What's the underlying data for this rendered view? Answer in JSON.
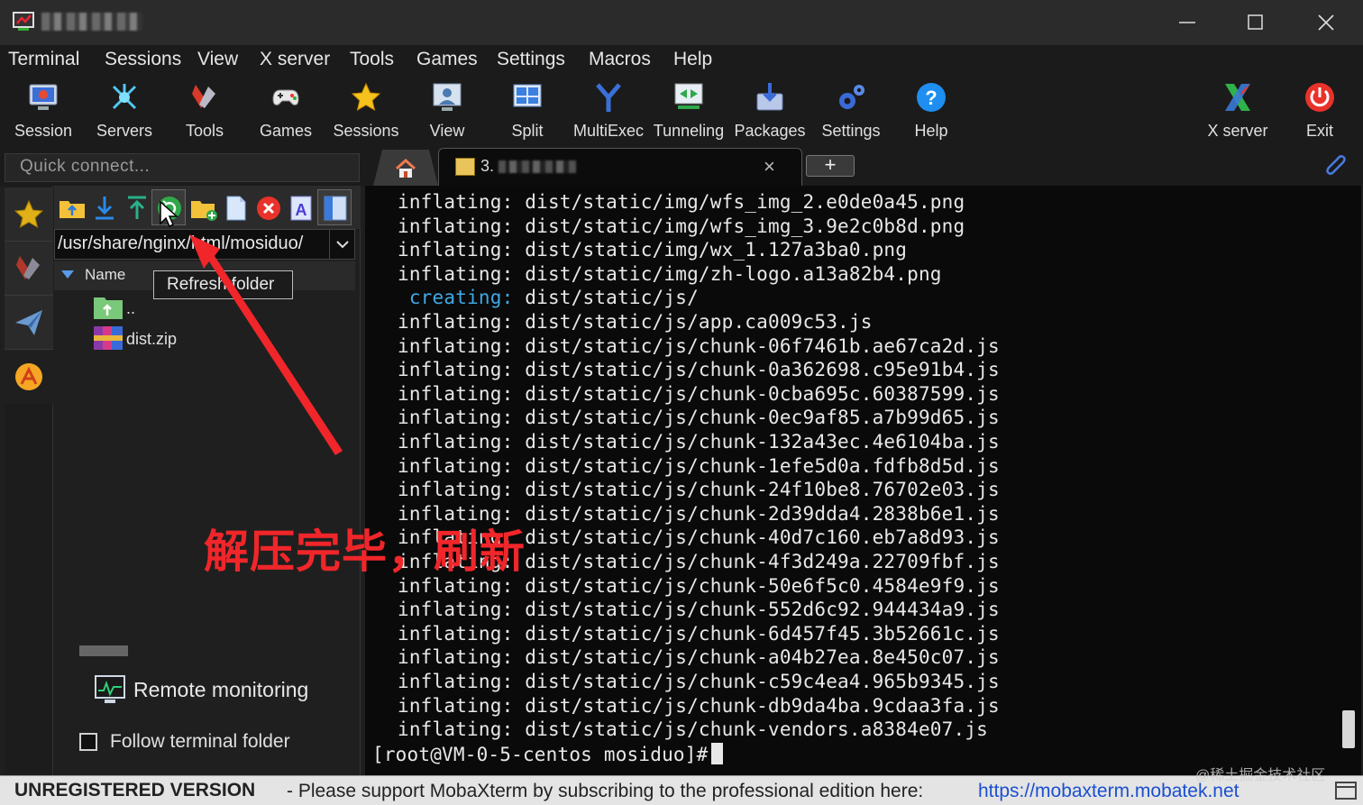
{
  "menu": [
    "Terminal",
    "Sessions",
    "View",
    "X server",
    "Tools",
    "Games",
    "Settings",
    "Macros",
    "Help"
  ],
  "toolbar": {
    "buttons": [
      "Session",
      "Servers",
      "Tools",
      "Games",
      "Sessions",
      "View",
      "Split",
      "MultiExec",
      "Tunneling",
      "Packages",
      "Settings",
      "Help"
    ],
    "right_buttons": [
      "X server",
      "Exit"
    ]
  },
  "quick_connect": {
    "placeholder": "Quick connect..."
  },
  "tabs": {
    "terminal_tab_prefix": "3."
  },
  "sftp": {
    "path": "/usr/share/nginx/html/mosiduo/",
    "column_name": "Name",
    "files": [
      "..",
      "dist.zip"
    ],
    "tooltip": "Refresh folder",
    "remote_monitoring": "Remote monitoring",
    "follow_terminal": "Follow terminal folder"
  },
  "terminal": {
    "lines": [
      {
        "verb": "inflating:",
        "path": "dist/static/img/wfs_img_2.e0de0a45.png"
      },
      {
        "verb": "inflating:",
        "path": "dist/static/img/wfs_img_3.9e2c0b8d.png"
      },
      {
        "verb": "inflating:",
        "path": "dist/static/img/wx_1.127a3ba0.png"
      },
      {
        "verb": "inflating:",
        "path": "dist/static/img/zh-logo.a13a82b4.png"
      },
      {
        "verb": " creating:",
        "path": "dist/static/js/"
      },
      {
        "verb": "inflating:",
        "path": "dist/static/js/app.ca009c53.js"
      },
      {
        "verb": "inflating:",
        "path": "dist/static/js/chunk-06f7461b.ae67ca2d.js"
      },
      {
        "verb": "inflating:",
        "path": "dist/static/js/chunk-0a362698.c95e91b4.js"
      },
      {
        "verb": "inflating:",
        "path": "dist/static/js/chunk-0cba695c.60387599.js"
      },
      {
        "verb": "inflating:",
        "path": "dist/static/js/chunk-0ec9af85.a7b99d65.js"
      },
      {
        "verb": "inflating:",
        "path": "dist/static/js/chunk-132a43ec.4e6104ba.js"
      },
      {
        "verb": "inflating:",
        "path": "dist/static/js/chunk-1efe5d0a.fdfb8d5d.js"
      },
      {
        "verb": "inflating:",
        "path": "dist/static/js/chunk-24f10be8.76702e03.js"
      },
      {
        "verb": "inflating:",
        "path": "dist/static/js/chunk-2d39dda4.2838b6e1.js"
      },
      {
        "verb": "inflating:",
        "path": "dist/static/js/chunk-40d7c160.eb7a8d93.js"
      },
      {
        "verb": "inflating:",
        "path": "dist/static/js/chunk-4f3d249a.22709fbf.js"
      },
      {
        "verb": "inflating:",
        "path": "dist/static/js/chunk-50e6f5c0.4584e9f9.js"
      },
      {
        "verb": "inflating:",
        "path": "dist/static/js/chunk-552d6c92.944434a9.js"
      },
      {
        "verb": "inflating:",
        "path": "dist/static/js/chunk-6d457f45.3b52661c.js"
      },
      {
        "verb": "inflating:",
        "path": "dist/static/js/chunk-a04b27ea.8e450c07.js"
      },
      {
        "verb": "inflating:",
        "path": "dist/static/js/chunk-c59c4ea4.965b9345.js"
      },
      {
        "verb": "inflating:",
        "path": "dist/static/js/chunk-db9da4ba.9cdaa3fa.js"
      },
      {
        "verb": "inflating:",
        "path": "dist/static/js/chunk-vendors.a8384e07.js"
      }
    ],
    "prompt": "[root@VM-0-5-centos mosiduo]#"
  },
  "annotation": "解压完毕，刷新",
  "status": {
    "unregistered": "UNREGISTERED VERSION",
    "message": "-  Please support MobaXterm by subscribing to the professional edition here:",
    "link": "https://mobaxterm.mobatek.net"
  },
  "watermark": "@稀土掘金技术社区",
  "colors": {
    "accent_red": "#f0262a",
    "creating_cyan": "#3fa9e6",
    "link_blue": "#1a4fd0"
  }
}
